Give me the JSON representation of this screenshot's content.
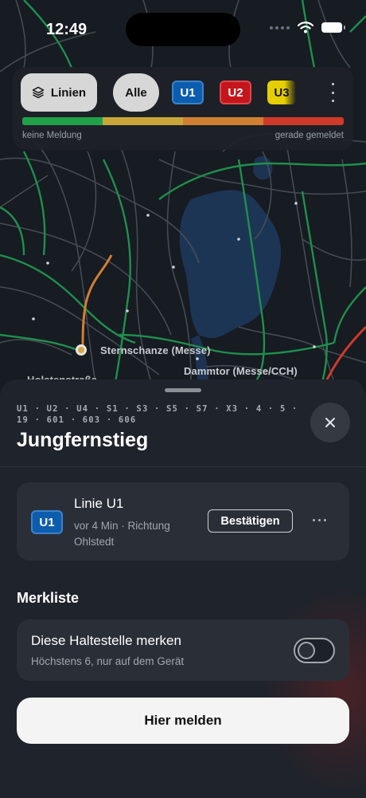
{
  "status_bar": {
    "time": "12:49"
  },
  "line_filter": {
    "lines_label": "Linien",
    "all_label": "Alle",
    "chips": [
      {
        "label": "U1",
        "color": "#0d5dae"
      },
      {
        "label": "U2",
        "color": "#c4161c"
      },
      {
        "label": "U3",
        "color": "#e6cf00"
      }
    ],
    "legend_left": "keine Meldung",
    "legend_right": "gerade gemeldet",
    "legend_colors": [
      "#21a04a",
      "#c9a53a",
      "#d07f33",
      "#cf3a2a"
    ]
  },
  "map": {
    "labels": {
      "sternschanze": "Sternschanze (Messe)",
      "dammtor": "Dammtor (Messe/CCH)",
      "holstenstrasse": "Holstenstraße"
    }
  },
  "sheet": {
    "lines": "U1 · U2 · U4 · S1 · S3 · S5 · S7 · X3 · 4 · 5 · 19 · 601 · 603 · 606",
    "title": "Jungfernstieg",
    "report": {
      "badge": "U1",
      "title": "Linie U1",
      "meta": "vor 4 Min · Richtung Ohlstedt",
      "confirm_label": "Bestätigen"
    },
    "watchlist": {
      "section_title": "Merkliste",
      "title": "Diese Haltestelle merken",
      "subtitle": "Höchstens 6, nur auf dem Gerät",
      "enabled": false
    },
    "report_here_label": "Hier melden"
  }
}
